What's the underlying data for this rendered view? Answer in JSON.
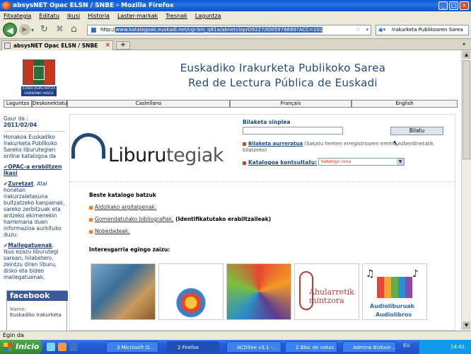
{
  "window": {
    "title": "absysNET Opac ELSN / SNBE - Mozilla Firefox",
    "controls": [
      "_",
      "□",
      "×"
    ]
  },
  "menu": [
    "Fitxategia",
    "Editatu",
    "Ikusi",
    "Historia",
    "Laster-markak",
    "Tresnak",
    "Laguntza"
  ],
  "nav": {
    "url_prefix": "http://",
    "url_selected": "www.katalogoak.euskadi.net/cgi-bin_q81a/abnetclop/O9227/ID05976689?ACC=101",
    "search_engine_text": "Irakurketa Publikoaren Sarea"
  },
  "tabs": [
    {
      "label": "absysNET Opac ELSN / SNBE"
    }
  ],
  "page": {
    "banner_line1": "Euskadiko Irakurketa Publikoko Sarea",
    "banner_line2": "Red de Lectura Pública de Euskadi",
    "gov_logo_text": "EUSKO JAURLARITZA GOBIERNO VASCO",
    "langbar": [
      "Laguntza",
      "Deskonektatu",
      "Castellano",
      "Français",
      "English"
    ],
    "sidebar": {
      "date_label": "Gaur da :",
      "date_value": "2011/02/04",
      "intro": "Honakoa Euskadiko Irakurketa Publikoko Sareko liburutegien online katalogoa da",
      "link1": "OPAC-a erabiltzen ikasi",
      "link2": "Zuretzat",
      "link2_text": ". Atal honetan irakurzaletasuna bultzatzeko kanpainak, sareko zerbitzuak eta antzeko ekimenekin harremana duen informazioa aurkituko duzu.",
      "link3": "Mailegatuenak",
      "link3_text": ". Ikus ezazu liburutegi sarean, hilabetero, zeintzu diren liburu, disko eta bideo mailegatuenak.",
      "fb_title": "facebook",
      "fb_name_label": "Name:",
      "fb_name_value": "Euskadiko Irakurketa"
    },
    "logo_text_plain": "Liburu",
    "logo_text_highlight": "tegiak",
    "search_simple_label": "Bilaketa sinplea",
    "search_button": "Bilatu",
    "advanced_link": "Bilaketa aurreratua",
    "advanced_note": "(Sakatu hemen erregistroaren eremu ezberdinetatik bilatzeko)",
    "catalog_link": "Katalogoa kontsultatu:",
    "catalog_select": "Katalogo osoa",
    "other_catalogs_title": "Beste katalogo batzuk",
    "other_links": [
      {
        "link": "Aldizkako argitalpenak.",
        "suffix": ""
      },
      {
        "link": "Gomendatutako bibliografiak.",
        "suffix": " (Identifikatutako erabiltzaileak)"
      },
      {
        "link": "Nobedadeak.",
        "suffix": ""
      }
    ],
    "interesting_title": "Interesgarria egingo zaizu:",
    "thumb4_text": "Ahularretik mintzora",
    "thumb5_text1": "Audioliburuak",
    "thumb5_text2": "Audiolibros"
  },
  "status": "Egin da",
  "taskbar": {
    "start": "Inicio",
    "tasks": [
      "3 Microsoft O...",
      "2 Firefox",
      "ACDSee v3.1 -...",
      "2 Bloc de notas",
      "Admina Bizkaie ..."
    ],
    "lang": "EU",
    "time": "14:41"
  },
  "colors": {
    "accent": "#1e4a7a",
    "facebook": "#3b5998",
    "logo_orange": "#e8771a"
  }
}
